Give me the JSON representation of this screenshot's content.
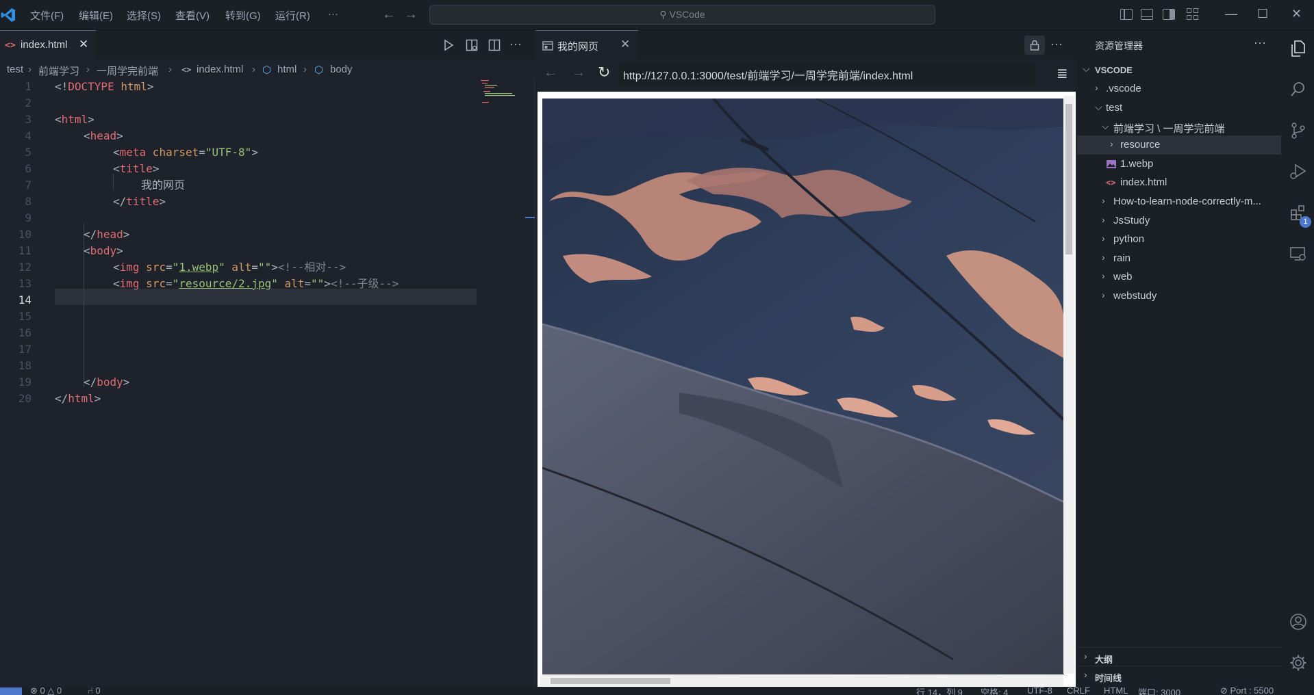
{
  "menu": [
    "文件(F)",
    "编辑(E)",
    "选择(S)",
    "查看(V)",
    "转到(G)",
    "运行(R)",
    "···"
  ],
  "search": {
    "text": "VSCode"
  },
  "editor_tab": {
    "label": "index.html",
    "close": "✕"
  },
  "breadcrumb": [
    "test",
    "前端学习",
    "一周学完前端",
    "index.html",
    "html",
    "body"
  ],
  "code_lines": [
    {
      "n": "1"
    },
    {
      "n": "2"
    },
    {
      "n": "3"
    },
    {
      "n": "4"
    },
    {
      "n": "5"
    },
    {
      "n": "6"
    },
    {
      "n": "7"
    },
    {
      "n": "8"
    },
    {
      "n": "9"
    },
    {
      "n": "10"
    },
    {
      "n": "11"
    },
    {
      "n": "12"
    },
    {
      "n": "13"
    },
    {
      "n": "14"
    },
    {
      "n": "15"
    },
    {
      "n": "16"
    },
    {
      "n": "17"
    },
    {
      "n": "18"
    },
    {
      "n": "19"
    },
    {
      "n": "20"
    }
  ],
  "code": {
    "l1": {
      "lt": "<!",
      "kw": "DOCTYPE",
      "v": " html",
      "gt": ">"
    },
    "l3": {
      "lt": "<",
      "tag": "html",
      "gt": ">"
    },
    "l4": {
      "lt": "<",
      "tag": "head",
      "gt": ">"
    },
    "l5": {
      "lt": "<",
      "tag": "meta",
      "attr": " charset",
      "eq": "=",
      "val": "\"UTF-8\"",
      "gt": ">"
    },
    "l6": {
      "lt": "<",
      "tag": "title",
      "gt": ">"
    },
    "l7": {
      "text": "我的网页"
    },
    "l8": {
      "lt": "</",
      "tag": "title",
      "gt": ">"
    },
    "l10": {
      "lt": "</",
      "tag": "head",
      "gt": ">"
    },
    "l11": {
      "lt": "<",
      "tag": "body",
      "gt": ">"
    },
    "l12": {
      "lt": "<",
      "tag": "img",
      "a1": " src",
      "eq1": "=",
      "q1": "\"",
      "src": "1.webp",
      "q2": "\"",
      "a2": " alt",
      "eq2": "=",
      "v2": "\"\"",
      "gt": ">",
      "comment": "<!--相对-->"
    },
    "l13": {
      "lt": "<",
      "tag": "img",
      "a1": " src",
      "eq1": "=",
      "q1": "\"",
      "src": "resource/2.jpg",
      "q2": "\"",
      "a2": " alt",
      "eq2": "=",
      "v2": "\"\"",
      "gt": ">",
      "comment": "<!--子级-->"
    },
    "l19": {
      "lt": "</",
      "tag": "body",
      "gt": ">"
    },
    "l20": {
      "lt": "</",
      "tag": "html",
      "gt": ">"
    }
  },
  "preview_tab": {
    "label": "我的网页",
    "close": "✕"
  },
  "browser": {
    "url": "http://127.0.0.1:3000/test/前端学习/一周学完前端/index.html"
  },
  "explorer": {
    "title": "资源管理器",
    "more": "···",
    "items": [
      {
        "label": "VSCODE",
        "depth": 0,
        "chev": "⌵"
      },
      {
        "label": ".vscode",
        "depth": 1,
        "chev": "›"
      },
      {
        "label": "test",
        "depth": 1,
        "chev": "⌵"
      },
      {
        "label": "前端学习 \\ 一周学完前端",
        "depth": 2,
        "chev": "⌵"
      },
      {
        "label": "resource",
        "depth": 3,
        "chev": "›"
      },
      {
        "label": "1.webp",
        "depth": 3
      },
      {
        "label": "index.html",
        "depth": 3
      },
      {
        "label": "How-to-learn-node-correctly-m...",
        "depth": 2,
        "chev": "›"
      },
      {
        "label": "JsStudy",
        "depth": 2,
        "chev": "›"
      },
      {
        "label": "python",
        "depth": 2,
        "chev": "›"
      },
      {
        "label": "rain",
        "depth": 2,
        "chev": "›"
      },
      {
        "label": "web",
        "depth": 2,
        "chev": "›"
      },
      {
        "label": "webstudy",
        "depth": 2,
        "chev": "›"
      }
    ],
    "outline": "大纲",
    "timeline": "时间线"
  },
  "activity_badge": "1",
  "status": {
    "errors": "⊗ 0 △ 0",
    "ports": "⑁ 0",
    "cursor": "行 14，列 9",
    "spaces": "空格: 4",
    "encoding": "UTF-8",
    "eol": "CRLF",
    "lang": "HTML",
    "port": "端口: 3000",
    "live": "⊘ Port : 5500"
  },
  "colors": {
    "accent": "#4d78cc",
    "tag": "#e06c75",
    "attr": "#d19a66",
    "string": "#98c379"
  }
}
